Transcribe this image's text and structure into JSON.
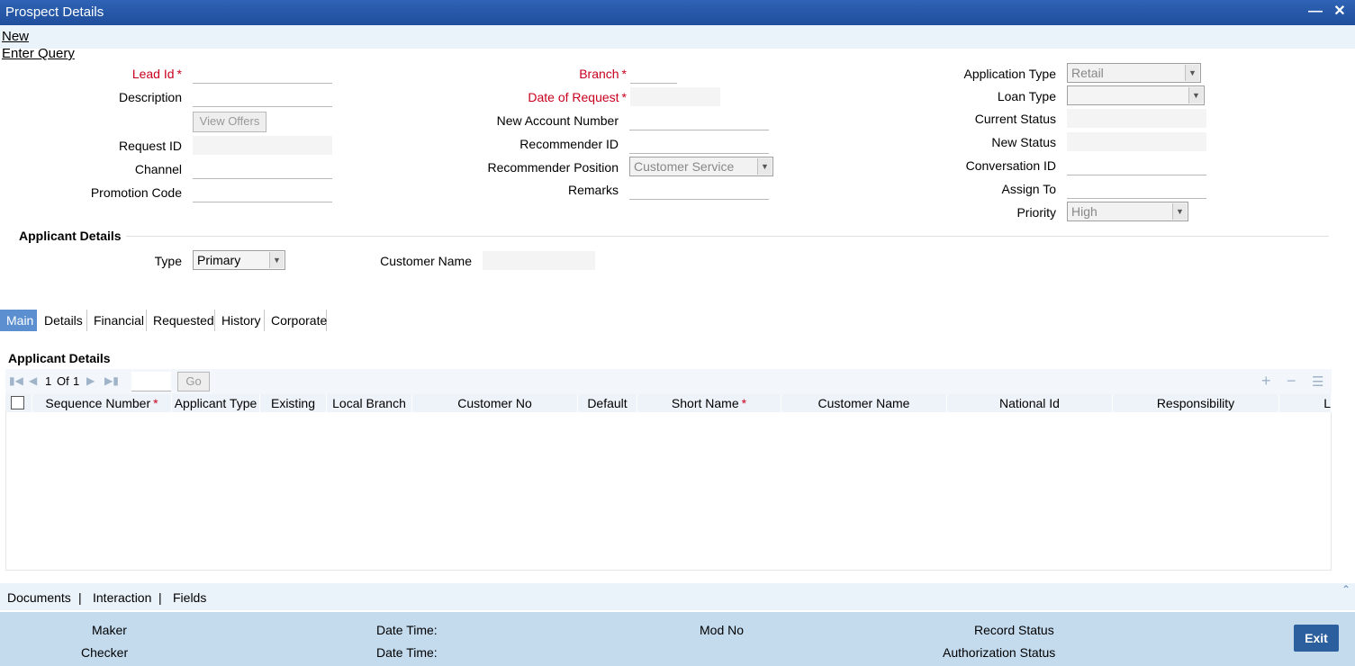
{
  "window": {
    "title": "Prospect Details"
  },
  "menu": {
    "new": "New",
    "enter_query": "Enter Query"
  },
  "form": {
    "lead_id": {
      "label": "Lead Id",
      "value": ""
    },
    "description": {
      "label": "Description",
      "value": ""
    },
    "view_offers": "View Offers",
    "request_id": {
      "label": "Request ID",
      "value": ""
    },
    "channel": {
      "label": "Channel",
      "value": ""
    },
    "promotion_code": {
      "label": "Promotion Code",
      "value": ""
    },
    "branch": {
      "label": "Branch",
      "value": ""
    },
    "date_of_request": {
      "label": "Date of Request",
      "value": ""
    },
    "new_account_number": {
      "label": "New Account Number",
      "value": ""
    },
    "recommender_id": {
      "label": "Recommender ID",
      "value": ""
    },
    "recommender_position": {
      "label": "Recommender Position",
      "value": "Customer Service"
    },
    "remarks": {
      "label": "Remarks",
      "value": ""
    },
    "application_type": {
      "label": "Application Type",
      "value": "Retail"
    },
    "loan_type": {
      "label": "Loan Type",
      "value": ""
    },
    "current_status": {
      "label": "Current Status",
      "value": ""
    },
    "new_status": {
      "label": "New Status",
      "value": ""
    },
    "conversation_id": {
      "label": "Conversation ID",
      "value": ""
    },
    "assign_to": {
      "label": "Assign To",
      "value": ""
    },
    "priority": {
      "label": "Priority",
      "value": "High"
    },
    "required_mark": "*"
  },
  "applicant": {
    "section_title": "Applicant Details",
    "type_label": "Type",
    "type_value": "Primary",
    "customer_name_label": "Customer Name",
    "customer_name_value": ""
  },
  "tabs": [
    "Main",
    "Details",
    "Financial",
    "Requested",
    "History",
    "Corporate"
  ],
  "grid": {
    "title": "Applicant Details",
    "pager": {
      "current": "1",
      "of": "Of",
      "total": "1",
      "go": "Go"
    },
    "columns": [
      "Sequence Number",
      "Applicant Type",
      "Existing",
      "Local Branch",
      "Customer No",
      "Default",
      "Short Name",
      "Customer Name",
      "National Id",
      "Responsibility",
      "L"
    ],
    "rows": []
  },
  "bottom_links": [
    "Documents",
    "Interaction",
    "Fields"
  ],
  "link_separator": "|",
  "footer": {
    "maker": "Maker",
    "checker": "Checker",
    "date_time": "Date Time:",
    "mod_no": "Mod No",
    "record_status": "Record Status",
    "authorization_status": "Authorization Status",
    "exit": "Exit"
  }
}
